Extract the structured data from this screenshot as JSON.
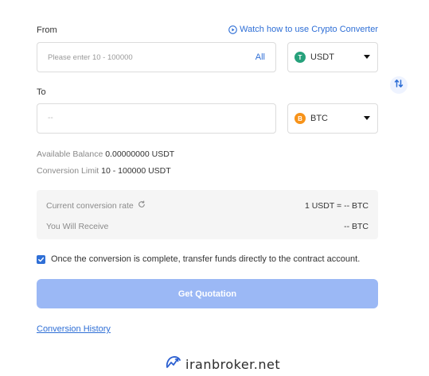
{
  "from": {
    "label": "From",
    "watch_link": "Watch how to use Crypto Converter",
    "amount_placeholder": "Please enter 10 - 100000",
    "all_label": "All",
    "currency": "USDT",
    "currency_icon": "tether-icon",
    "currency_color": "#26a17b"
  },
  "to": {
    "label": "To",
    "amount_placeholder": "--",
    "currency": "BTC",
    "currency_icon": "bitcoin-icon",
    "currency_color": "#f7931a"
  },
  "swap": {
    "icon": "swap-arrows-icon"
  },
  "info": {
    "balance_label": "Available Balance",
    "balance_value": "0.00000000 USDT",
    "limit_label": "Conversion Limit",
    "limit_value": "10 - 100000 USDT"
  },
  "rate": {
    "current_label": "Current conversion rate",
    "current_value": "1 USDT = -- BTC",
    "receive_label": "You Will Receive",
    "receive_value": "-- BTC"
  },
  "transfer": {
    "checked": true,
    "text": "Once the conversion is complete, transfer funds directly to the contract account."
  },
  "quote_button": "Get Quotation",
  "history_link": "Conversion History",
  "watermark": "iranbroker.net",
  "colors": {
    "accent": "#2f6fd6",
    "button_disabled": "#9bb8f5",
    "panel_bg": "#f5f5f5"
  }
}
